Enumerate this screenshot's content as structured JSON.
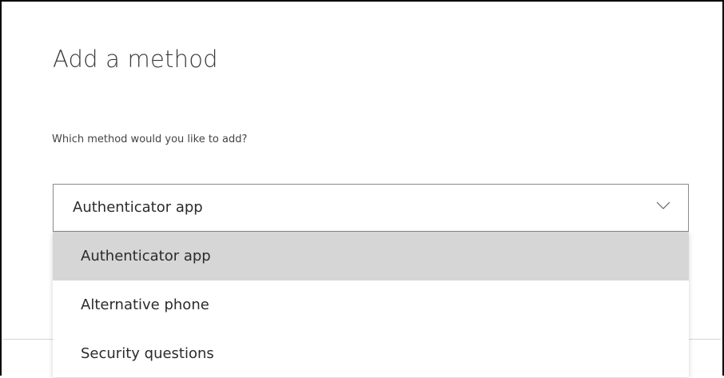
{
  "dialog": {
    "title": "Add a method",
    "question": "Which method would you like to add?"
  },
  "method_select": {
    "selected_value": "Authenticator app",
    "chevron_icon": "chevron-down-icon",
    "options": [
      {
        "label": "Authenticator app",
        "highlighted": true
      },
      {
        "label": "Alternative phone",
        "highlighted": false
      },
      {
        "label": "Security questions",
        "highlighted": false
      }
    ]
  },
  "colors": {
    "highlight": "#d6d6d6",
    "border": "#8a8a8a",
    "text": "#2b2b2b"
  }
}
